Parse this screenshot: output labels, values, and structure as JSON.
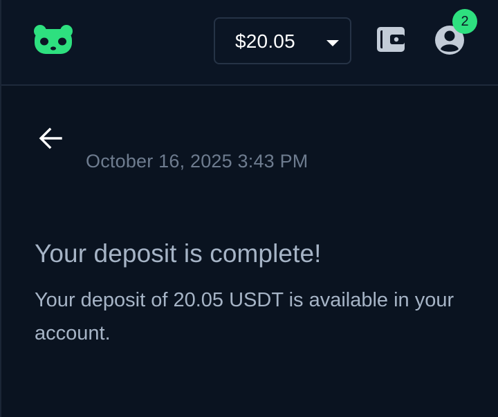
{
  "header": {
    "balance": "$20.05",
    "notification_count": "2"
  },
  "deposit": {
    "timestamp": "October 16, 2025 3:43 PM",
    "title": "Your deposit is complete!",
    "message": "Your deposit of 20.05 USDT is available in your account."
  },
  "icons": {
    "logo": "panda-logo",
    "wallet": "wallet-icon",
    "account": "user-circle-icon",
    "back": "arrow-left-icon",
    "caret": "chevron-down-icon"
  },
  "colors": {
    "background": "#0a1320",
    "header_bg": "#0b1524",
    "brand_green": "#2ee07f",
    "icon_gray": "#c3ccd8",
    "text_muted": "#6e7c8f",
    "text_body": "#a6b4c6"
  }
}
